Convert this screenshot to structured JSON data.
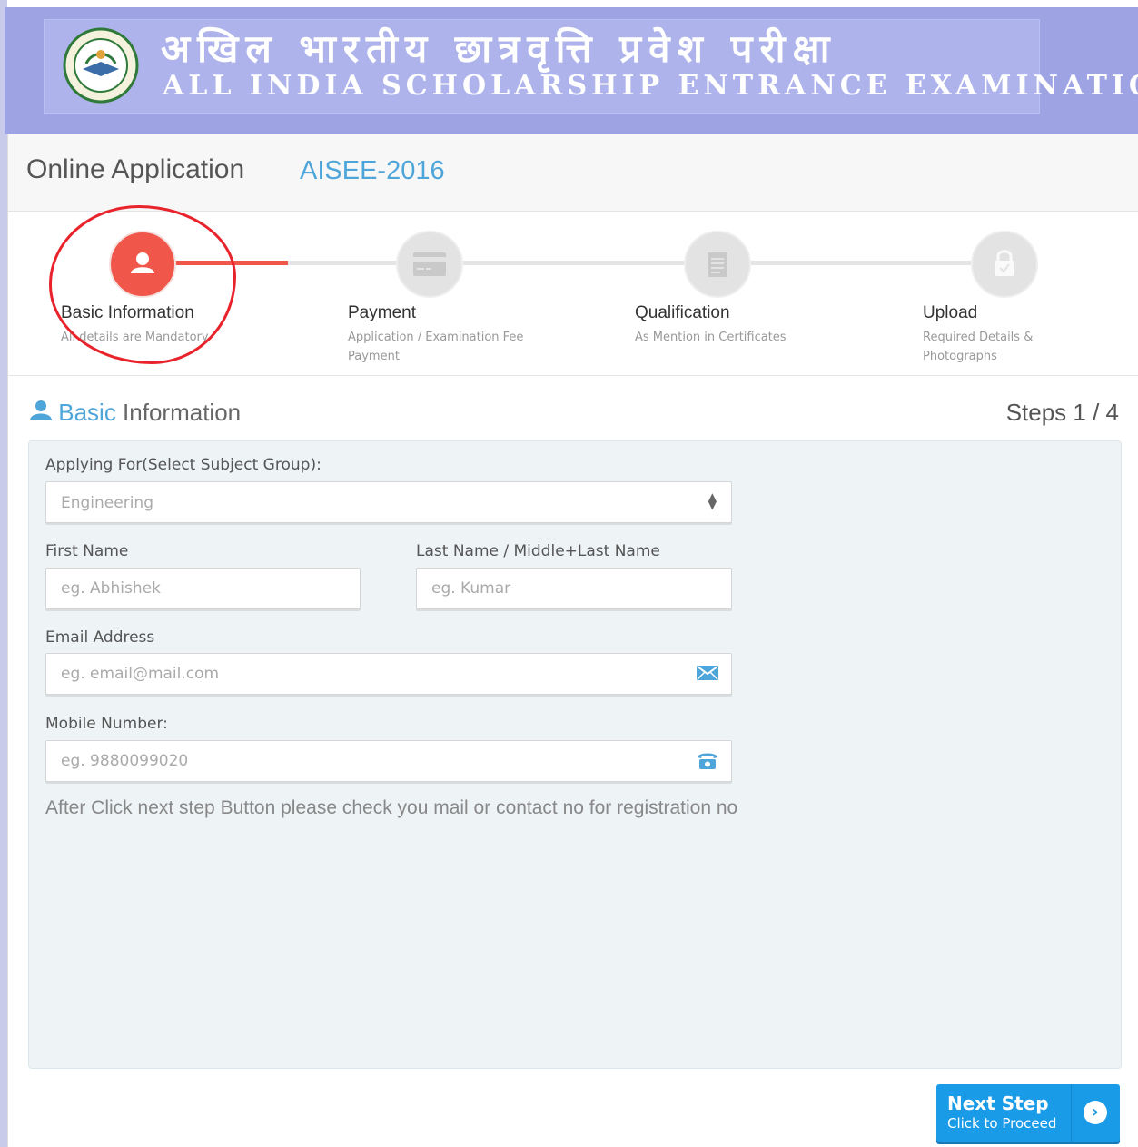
{
  "banner": {
    "title_hindi": "अखिल भारतीय छात्रवृत्ति प्रवेश परीक्षा",
    "title_english": "ALL INDIA SCHOLARSHIP ENTRANCE EXAMINATION"
  },
  "header": {
    "title": "Online Application",
    "exam": "AISEE-2016"
  },
  "steps": [
    {
      "title": "Basic Information",
      "subtitle": "All details are Mandatory",
      "icon": "user-icon",
      "active": true
    },
    {
      "title": "Payment",
      "subtitle": "Application / Examination Fee Payment",
      "icon": "credit-card-icon",
      "active": false
    },
    {
      "title": "Qualification",
      "subtitle": "As Mention in Certificates",
      "icon": "document-icon",
      "active": false
    },
    {
      "title": "Upload",
      "subtitle": "Required Details & Photographs",
      "icon": "lock-icon",
      "active": false
    }
  ],
  "section": {
    "title_accent": "Basic",
    "title_rest": "Information",
    "steps_count": "Steps 1 / 4"
  },
  "form": {
    "subject_group": {
      "label": "Applying For(Select Subject Group):",
      "value": "Engineering"
    },
    "first_name": {
      "label": "First Name",
      "placeholder": "eg. Abhishek"
    },
    "last_name": {
      "label": "Last Name / Middle+Last Name",
      "placeholder": "eg. Kumar"
    },
    "email": {
      "label": "Email Address",
      "placeholder": "eg. email@mail.com",
      "icon": "envelope-icon"
    },
    "mobile": {
      "label": "Mobile Number:",
      "placeholder": "eg. 9880099020",
      "icon": "phone-icon"
    },
    "note": "After Click next step Button please check you mail or contact no for registration no"
  },
  "next_button": {
    "label": "Next Step",
    "sublabel": "Click to Proceed"
  },
  "colors": {
    "accent_blue": "#4ea5d9",
    "active_step": "#f0564a",
    "button": "#1a9be8",
    "banner": "#9ea4e3"
  }
}
